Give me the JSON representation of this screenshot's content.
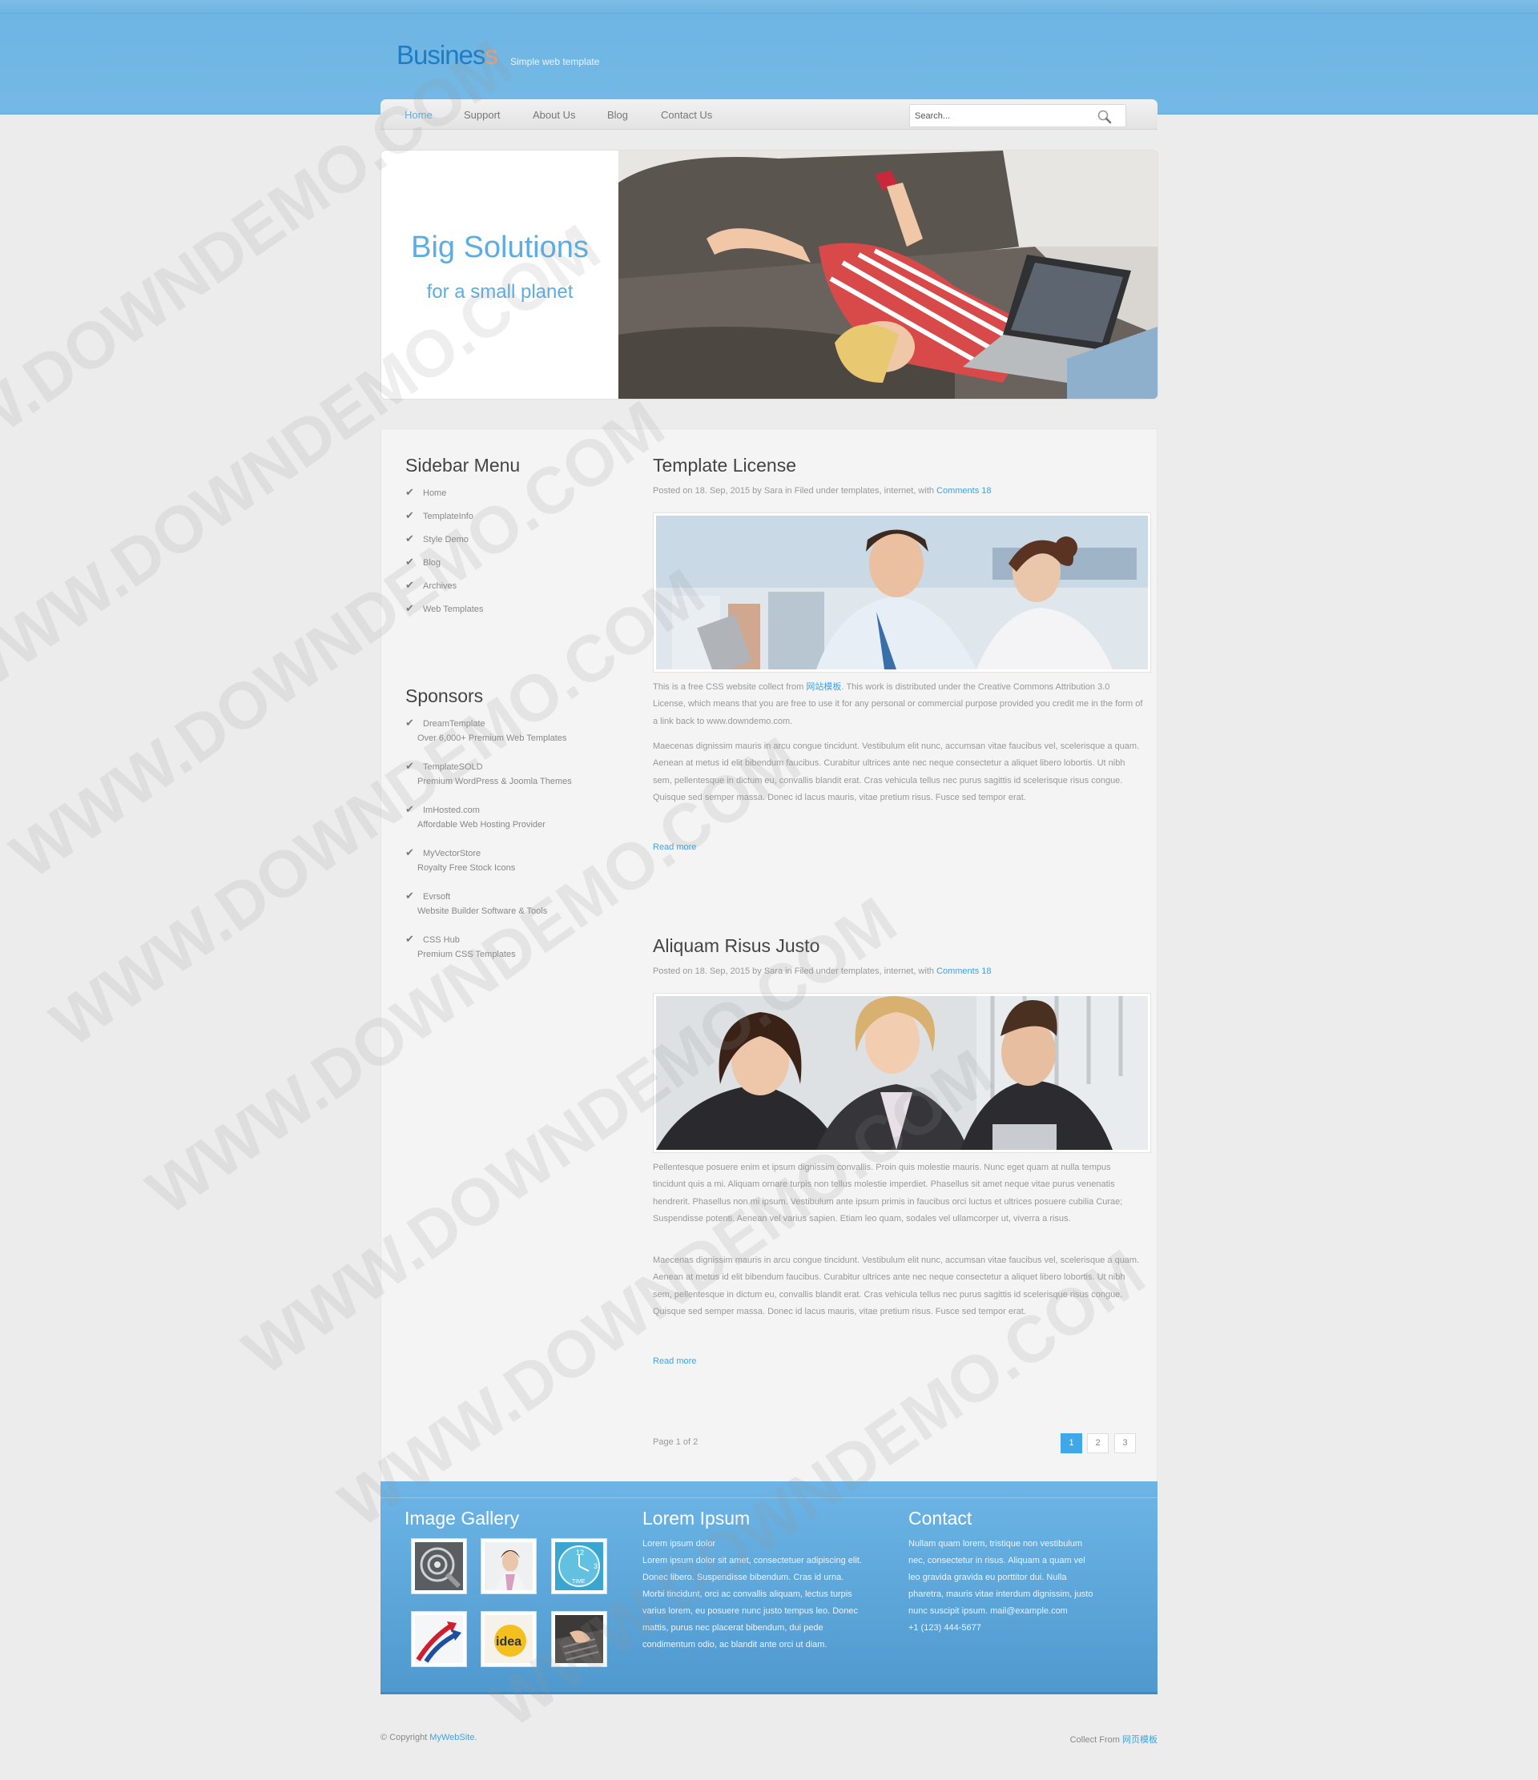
{
  "header": {
    "logo_main": "Busines",
    "logo_last": "s",
    "tagline": "Simple web template"
  },
  "nav": {
    "items": [
      "Home",
      "Support",
      "About Us",
      "Blog",
      "Contact Us"
    ],
    "active": "Home",
    "search_placeholder": "Search..."
  },
  "banner": {
    "title": "Big Solutions",
    "subtitle": "for a small planet"
  },
  "sidebar": {
    "menu_title": "Sidebar Menu",
    "menu_items": [
      "Home",
      "TemplateInfo",
      "Style Demo",
      "Blog",
      "Archives",
      "Web Templates"
    ],
    "sponsors_title": "Sponsors",
    "sponsors": [
      {
        "name": "DreamTemplate",
        "desc": "Over 6,000+ Premium Web Templates"
      },
      {
        "name": "TemplateSOLD",
        "desc": "Premium WordPress & Joomla Themes"
      },
      {
        "name": "ImHosted.com",
        "desc": "Affordable Web Hosting Provider"
      },
      {
        "name": "MyVectorStore",
        "desc": "Royalty Free Stock Icons"
      },
      {
        "name": "Evrsoft",
        "desc": "Website Builder Software & Tools"
      },
      {
        "name": "CSS Hub",
        "desc": "Premium CSS Templates"
      }
    ]
  },
  "posts": [
    {
      "title": "Template License",
      "meta": "Posted on 18. Sep, 2015 by Sara in Filed under templates, internet, with ",
      "comments": "Comments 18",
      "p1_before": "This is a free CSS website collect from ",
      "p1_link": "网站模板",
      "p1_after": ". This work is distributed under the Creative Commons Attribution 3.0 License, which means that you are free to use it for any personal or commercial purpose provided you credit me in the form of a link back to www.downdemo.com.",
      "p2": "Maecenas dignissim mauris in arcu congue tincidunt. Vestibulum elit nunc, accumsan vitae faucibus vel, scelerisque a quam. Aenean at metus id elit bibendum faucibus. Curabitur ultrices ante nec neque consectetur a aliquet libero lobortis. Ut nibh sem, pellentesque in dictum eu, convallis blandit erat. Cras vehicula tellus nec purus sagittis id scelerisque risus congue. Quisque sed semper massa. Donec id lacus mauris, vitae pretium risus. Fusce sed tempor erat.",
      "read_more": "Read more"
    },
    {
      "title": "Aliquam Risus Justo",
      "meta": "Posted on 18. Sep, 2015 by Sara in Filed under templates, internet, with ",
      "comments": "Comments 18",
      "p1": "Pellentesque posuere enim et ipsum dignissim convallis. Proin quis molestie mauris. Nunc eget quam at nulla tempus tincidunt quis a mi. Aliquam ornare turpis non tellus molestie imperdiet. Phasellus sit amet neque vitae purus venenatis hendrerit. Phasellus non mi ipsum. Vestibulum ante ipsum primis in faucibus orci luctus et ultrices posuere cubilia Curae; Suspendisse potenti. Aenean vel varius sapien. Etiam leo quam, sodales vel ullamcorper ut, viverra a risus.",
      "p2": "Maecenas dignissim mauris in arcu congue tincidunt. Vestibulum elit nunc, accumsan vitae faucibus vel, scelerisque a quam. Aenean at metus id elit bibendum faucibus. Curabitur ultrices ante nec neque consectetur a aliquet libero lobortis. Ut nibh sem, pellentesque in dictum eu, convallis blandit erat. Cras vehicula tellus nec purus sagittis id scelerisque risus congue. Quisque sed semper massa. Donec id lacus mauris, vitae pretium risus. Fusce sed tempor erat.",
      "read_more": "Read more"
    }
  ],
  "pagination": {
    "info": "Page 1 of 2",
    "pages": [
      "1",
      "2",
      "3"
    ],
    "current": "1"
  },
  "footer": {
    "gallery_title": "Image Gallery",
    "lorem_title": "Lorem Ipsum",
    "lorem_lines": [
      "Lorem ipsum dolor",
      "Lorem ipsum dolor sit amet, consectetuer adipiscing elit.",
      "Donec libero. Suspendisse bibendum. Cras id urna.",
      "Morbi tincidunt, orci ac convallis aliquam, lectus turpis",
      "varius lorem, eu posuere nunc justo tempus leo. Donec",
      "mattis, purus nec placerat bibendum, dui pede",
      "condimentum odio, ac blandit ante orci ut diam."
    ],
    "contact_title": "Contact",
    "contact_lines": [
      "Nullam quam lorem, tristique non vestibulum",
      "nec, consectetur in risus. Aliquam a quam vel",
      "leo gravida gravida eu porttitor dui. Nulla",
      "pharetra, mauris vitae interdum dignissim, justo",
      "nunc suscipit ipsum. mail@example.com",
      "+1 (123) 444-5677"
    ],
    "thumb_clock_label": "TIME",
    "thumb_idea_label": "idea"
  },
  "bottom": {
    "copyright_prefix": "© Copyright ",
    "copyright_link": "MyWebSite",
    "copyright_suffix": ".",
    "collect_prefix": "Collect From ",
    "collect_link": "网页模板"
  },
  "watermark_text": "WWW.DOWNDEMO.COM",
  "colors": {
    "accent": "#5dade2",
    "link": "#3fa3de",
    "header": "#74b9e6",
    "footer": "#5aa5da"
  }
}
